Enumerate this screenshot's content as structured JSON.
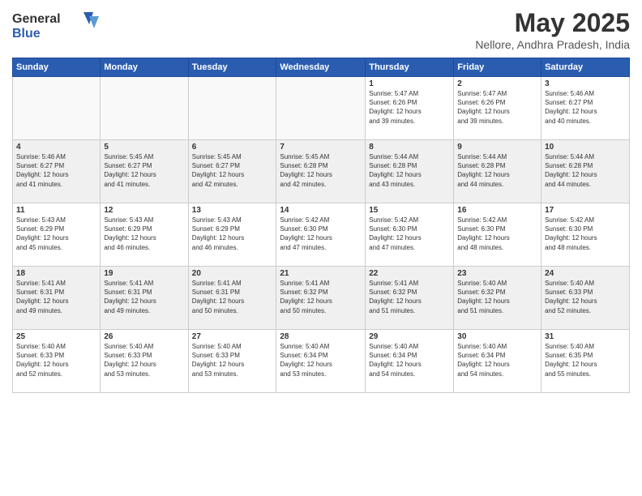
{
  "logo": {
    "general": "General",
    "blue": "Blue"
  },
  "header": {
    "month_year": "May 2025",
    "location": "Nellore, Andhra Pradesh, India"
  },
  "days_of_week": [
    "Sunday",
    "Monday",
    "Tuesday",
    "Wednesday",
    "Thursday",
    "Friday",
    "Saturday"
  ],
  "weeks": [
    {
      "days": [
        {
          "num": "",
          "info": "",
          "empty": true
        },
        {
          "num": "",
          "info": "",
          "empty": true
        },
        {
          "num": "",
          "info": "",
          "empty": true
        },
        {
          "num": "",
          "info": "",
          "empty": true
        },
        {
          "num": "1",
          "info": "Sunrise: 5:47 AM\nSunset: 6:26 PM\nDaylight: 12 hours\nand 39 minutes.",
          "empty": false
        },
        {
          "num": "2",
          "info": "Sunrise: 5:47 AM\nSunset: 6:26 PM\nDaylight: 12 hours\nand 39 minutes.",
          "empty": false
        },
        {
          "num": "3",
          "info": "Sunrise: 5:46 AM\nSunset: 6:27 PM\nDaylight: 12 hours\nand 40 minutes.",
          "empty": false
        }
      ]
    },
    {
      "days": [
        {
          "num": "4",
          "info": "Sunrise: 5:46 AM\nSunset: 6:27 PM\nDaylight: 12 hours\nand 41 minutes.",
          "empty": false
        },
        {
          "num": "5",
          "info": "Sunrise: 5:45 AM\nSunset: 6:27 PM\nDaylight: 12 hours\nand 41 minutes.",
          "empty": false
        },
        {
          "num": "6",
          "info": "Sunrise: 5:45 AM\nSunset: 6:27 PM\nDaylight: 12 hours\nand 42 minutes.",
          "empty": false
        },
        {
          "num": "7",
          "info": "Sunrise: 5:45 AM\nSunset: 6:28 PM\nDaylight: 12 hours\nand 42 minutes.",
          "empty": false
        },
        {
          "num": "8",
          "info": "Sunrise: 5:44 AM\nSunset: 6:28 PM\nDaylight: 12 hours\nand 43 minutes.",
          "empty": false
        },
        {
          "num": "9",
          "info": "Sunrise: 5:44 AM\nSunset: 6:28 PM\nDaylight: 12 hours\nand 44 minutes.",
          "empty": false
        },
        {
          "num": "10",
          "info": "Sunrise: 5:44 AM\nSunset: 6:28 PM\nDaylight: 12 hours\nand 44 minutes.",
          "empty": false
        }
      ]
    },
    {
      "days": [
        {
          "num": "11",
          "info": "Sunrise: 5:43 AM\nSunset: 6:29 PM\nDaylight: 12 hours\nand 45 minutes.",
          "empty": false
        },
        {
          "num": "12",
          "info": "Sunrise: 5:43 AM\nSunset: 6:29 PM\nDaylight: 12 hours\nand 46 minutes.",
          "empty": false
        },
        {
          "num": "13",
          "info": "Sunrise: 5:43 AM\nSunset: 6:29 PM\nDaylight: 12 hours\nand 46 minutes.",
          "empty": false
        },
        {
          "num": "14",
          "info": "Sunrise: 5:42 AM\nSunset: 6:30 PM\nDaylight: 12 hours\nand 47 minutes.",
          "empty": false
        },
        {
          "num": "15",
          "info": "Sunrise: 5:42 AM\nSunset: 6:30 PM\nDaylight: 12 hours\nand 47 minutes.",
          "empty": false
        },
        {
          "num": "16",
          "info": "Sunrise: 5:42 AM\nSunset: 6:30 PM\nDaylight: 12 hours\nand 48 minutes.",
          "empty": false
        },
        {
          "num": "17",
          "info": "Sunrise: 5:42 AM\nSunset: 6:30 PM\nDaylight: 12 hours\nand 48 minutes.",
          "empty": false
        }
      ]
    },
    {
      "days": [
        {
          "num": "18",
          "info": "Sunrise: 5:41 AM\nSunset: 6:31 PM\nDaylight: 12 hours\nand 49 minutes.",
          "empty": false
        },
        {
          "num": "19",
          "info": "Sunrise: 5:41 AM\nSunset: 6:31 PM\nDaylight: 12 hours\nand 49 minutes.",
          "empty": false
        },
        {
          "num": "20",
          "info": "Sunrise: 5:41 AM\nSunset: 6:31 PM\nDaylight: 12 hours\nand 50 minutes.",
          "empty": false
        },
        {
          "num": "21",
          "info": "Sunrise: 5:41 AM\nSunset: 6:32 PM\nDaylight: 12 hours\nand 50 minutes.",
          "empty": false
        },
        {
          "num": "22",
          "info": "Sunrise: 5:41 AM\nSunset: 6:32 PM\nDaylight: 12 hours\nand 51 minutes.",
          "empty": false
        },
        {
          "num": "23",
          "info": "Sunrise: 5:40 AM\nSunset: 6:32 PM\nDaylight: 12 hours\nand 51 minutes.",
          "empty": false
        },
        {
          "num": "24",
          "info": "Sunrise: 5:40 AM\nSunset: 6:33 PM\nDaylight: 12 hours\nand 52 minutes.",
          "empty": false
        }
      ]
    },
    {
      "days": [
        {
          "num": "25",
          "info": "Sunrise: 5:40 AM\nSunset: 6:33 PM\nDaylight: 12 hours\nand 52 minutes.",
          "empty": false
        },
        {
          "num": "26",
          "info": "Sunrise: 5:40 AM\nSunset: 6:33 PM\nDaylight: 12 hours\nand 53 minutes.",
          "empty": false
        },
        {
          "num": "27",
          "info": "Sunrise: 5:40 AM\nSunset: 6:33 PM\nDaylight: 12 hours\nand 53 minutes.",
          "empty": false
        },
        {
          "num": "28",
          "info": "Sunrise: 5:40 AM\nSunset: 6:34 PM\nDaylight: 12 hours\nand 53 minutes.",
          "empty": false
        },
        {
          "num": "29",
          "info": "Sunrise: 5:40 AM\nSunset: 6:34 PM\nDaylight: 12 hours\nand 54 minutes.",
          "empty": false
        },
        {
          "num": "30",
          "info": "Sunrise: 5:40 AM\nSunset: 6:34 PM\nDaylight: 12 hours\nand 54 minutes.",
          "empty": false
        },
        {
          "num": "31",
          "info": "Sunrise: 5:40 AM\nSunset: 6:35 PM\nDaylight: 12 hours\nand 55 minutes.",
          "empty": false
        }
      ]
    }
  ]
}
